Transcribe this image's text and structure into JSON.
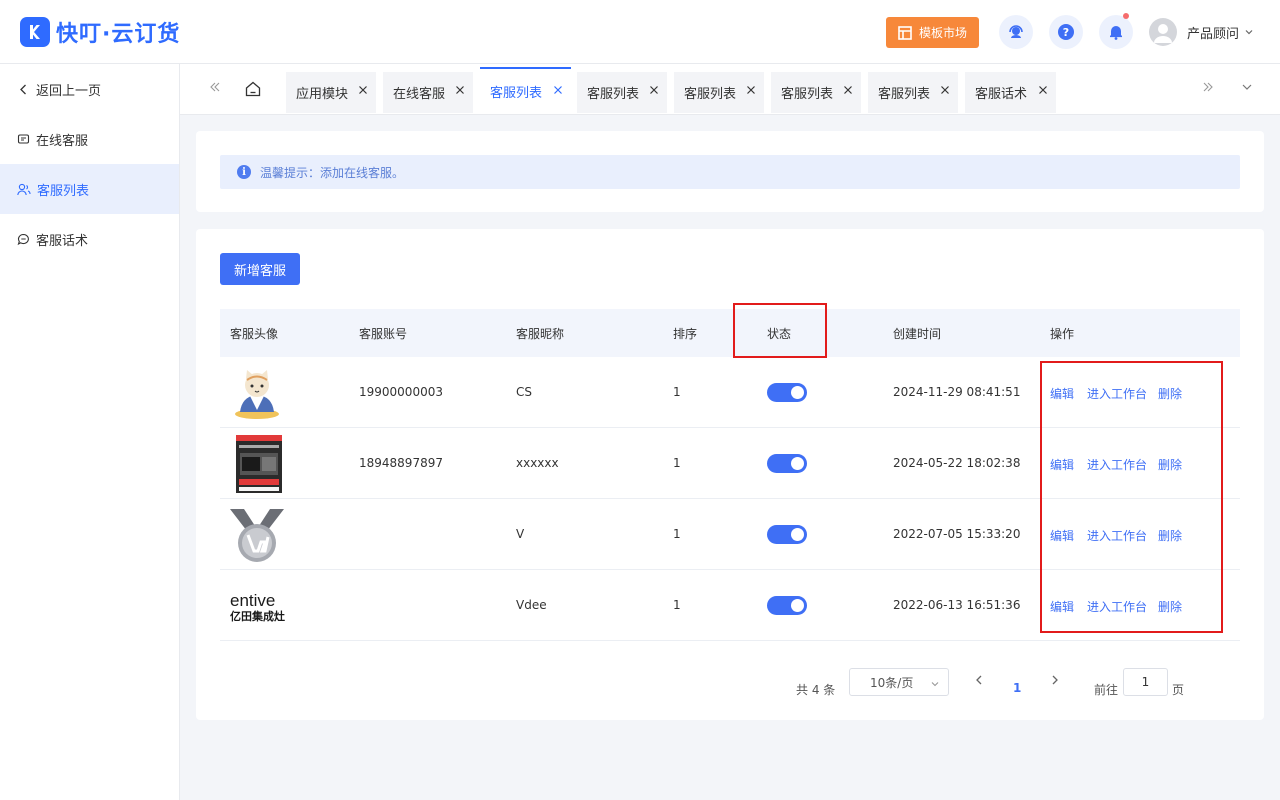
{
  "app": {
    "name": "快叮·云订货"
  },
  "header": {
    "template_button": "模板市场",
    "user_name": "产品顾问"
  },
  "sidebar": {
    "items": [
      {
        "label": "返回上一页",
        "icon": "chevron-left-icon"
      },
      {
        "label": "在线客服",
        "icon": "message-icon"
      },
      {
        "label": "客服列表",
        "icon": "users-icon",
        "active": true
      },
      {
        "label": "客服话术",
        "icon": "chat-bubble-icon"
      }
    ]
  },
  "tabs": [
    {
      "label": "应用模块"
    },
    {
      "label": "在线客服"
    },
    {
      "label": "客服列表",
      "active": true
    },
    {
      "label": "客服列表"
    },
    {
      "label": "客服列表"
    },
    {
      "label": "客服列表"
    },
    {
      "label": "客服列表"
    },
    {
      "label": "客服话术"
    }
  ],
  "tip": {
    "text": "温馨提示：添加在线客服。"
  },
  "add_button": "新增客服",
  "table": {
    "columns": [
      "客服头像",
      "客服账号",
      "客服昵称",
      "排序",
      "状态",
      "创建时间",
      "操作"
    ],
    "rows": [
      {
        "avatar": "cat-mascot-avatar",
        "account": "19900000003",
        "nickname": "CS",
        "sort": "1",
        "status": true,
        "created": "2024-11-29 08:41:51"
      },
      {
        "avatar": "product-poster-avatar",
        "account": "18948897897",
        "nickname": "xxxxxx",
        "sort": "1",
        "status": true,
        "created": "2024-05-22 18:02:38"
      },
      {
        "avatar": "medal-v-avatar",
        "account": "",
        "nickname": "V",
        "sort": "1",
        "status": true,
        "created": "2022-07-05 15:33:20"
      },
      {
        "avatar": "entive-logo-avatar",
        "account": "",
        "nickname": "Vdee",
        "sort": "1",
        "status": true,
        "created": "2022-06-13 16:51:36"
      }
    ],
    "actions": [
      "编辑",
      "进入工作台",
      "删除"
    ]
  },
  "logo4": {
    "line1": "entive",
    "line2": "亿田集成灶"
  },
  "pagination": {
    "total": "共 4 条",
    "page_size": "10条/页",
    "current": "1",
    "goto_label": "前往",
    "goto_value": "1",
    "page_suffix": "页"
  },
  "colors": {
    "primary": "#3f6ff5",
    "template_button": "#f7883a",
    "highlight_box": "#e21b1b"
  }
}
